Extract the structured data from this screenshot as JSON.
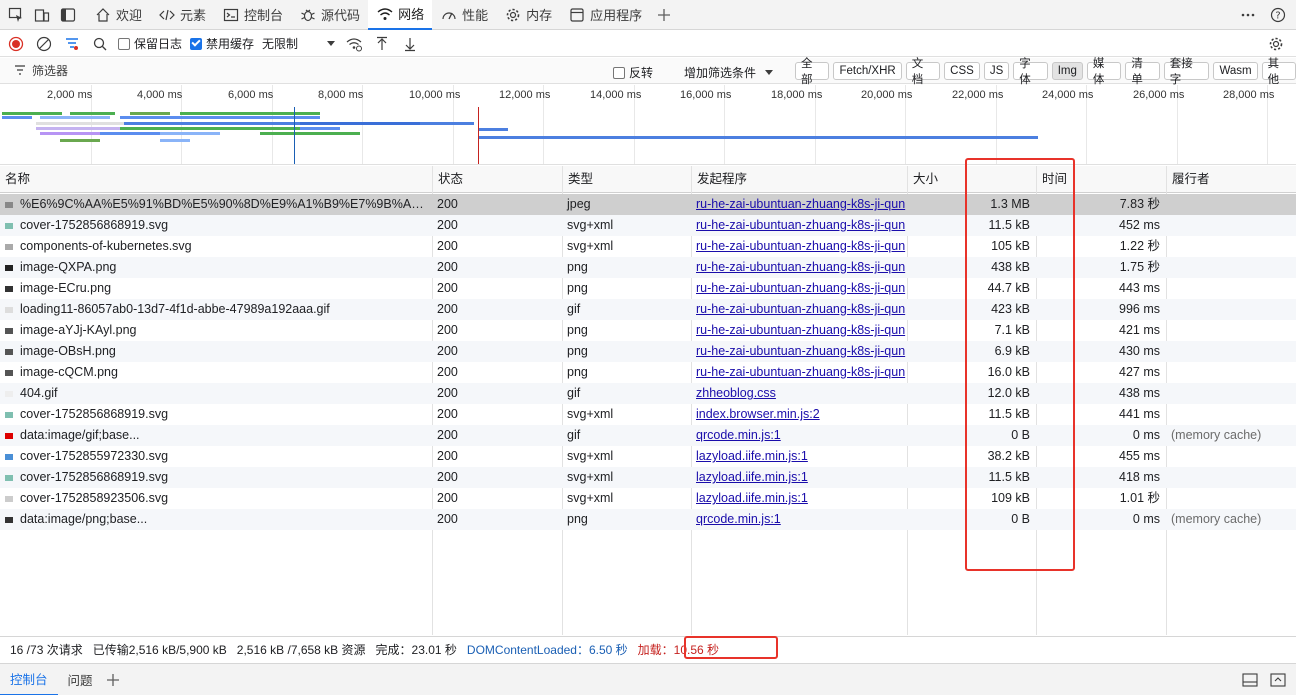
{
  "tabs": [
    {
      "label": "欢迎",
      "icon": "home-icon",
      "active": false
    },
    {
      "label": "元素",
      "icon": "code-icon",
      "active": false
    },
    {
      "label": "控制台",
      "icon": "console-icon",
      "active": false
    },
    {
      "label": "源代码",
      "icon": "bug-icon",
      "active": false
    },
    {
      "label": "网络",
      "icon": "wifi-icon",
      "active": true
    },
    {
      "label": "性能",
      "icon": "gauge-icon",
      "active": false
    },
    {
      "label": "内存",
      "icon": "gear-icon",
      "active": false
    },
    {
      "label": "应用程序",
      "icon": "app-icon",
      "active": false
    }
  ],
  "toolbar": {
    "preserve_log_label": "保留日志",
    "preserve_log_checked": false,
    "disable_cache_label": "禁用缓存",
    "disable_cache_checked": true,
    "throttle_label": "无限制"
  },
  "filterbar": {
    "filter_placeholder": "筛选器",
    "invert_label": "反转",
    "add_filter_label": "增加筛选条件",
    "types": [
      "全部",
      "Fetch/XHR",
      "文档",
      "CSS",
      "JS",
      "字体",
      "Img",
      "媒体",
      "清单",
      "套接字",
      "Wasm",
      "其他"
    ],
    "active_type": "Img"
  },
  "timeline": {
    "ticks": [
      "2,000 ms",
      "4,000 ms",
      "6,000 ms",
      "8,000 ms",
      "10,000 ms",
      "12,000 ms",
      "14,000 ms",
      "16,000 ms",
      "18,000 ms",
      "20,000 ms",
      "22,000 ms",
      "24,000 ms",
      "26,000 ms",
      "28,000 ms"
    ],
    "colors": {
      "dom_content_loaded": "#1a5fb4",
      "load": "#c5221f"
    }
  },
  "table": {
    "headers": {
      "name": "名称",
      "status": "状态",
      "type": "类型",
      "initiator": "发起程序",
      "size": "大小",
      "time": "时间",
      "fulfilled_by": "履行者"
    },
    "rows": [
      {
        "name": "%E6%9C%AA%E5%91%BD%E5%90%8D%E9%A1%B9%E7%9B%AE-...",
        "status": "200",
        "type": "jpeg",
        "initiator": "ru-he-zai-ubuntuan-zhuang-k8s-ji-qun",
        "size": "1.3 MB",
        "time": "7.83 秒",
        "fulfilled": "",
        "icon": "#888"
      },
      {
        "name": "cover-1752856868919.svg",
        "status": "200",
        "type": "svg+xml",
        "initiator": "ru-he-zai-ubuntuan-zhuang-k8s-ji-qun",
        "size": "11.5 kB",
        "time": "452 ms",
        "fulfilled": "",
        "icon": "#7fbfb0"
      },
      {
        "name": "components-of-kubernetes.svg",
        "status": "200",
        "type": "svg+xml",
        "initiator": "ru-he-zai-ubuntuan-zhuang-k8s-ji-qun",
        "size": "105 kB",
        "time": "1.22 秒",
        "fulfilled": "",
        "icon": "#aaa"
      },
      {
        "name": "image-QXPA.png",
        "status": "200",
        "type": "png",
        "initiator": "ru-he-zai-ubuntuan-zhuang-k8s-ji-qun",
        "size": "438 kB",
        "time": "1.75 秒",
        "fulfilled": "",
        "icon": "#222"
      },
      {
        "name": "image-ECru.png",
        "status": "200",
        "type": "png",
        "initiator": "ru-he-zai-ubuntuan-zhuang-k8s-ji-qun",
        "size": "44.7 kB",
        "time": "443 ms",
        "fulfilled": "",
        "icon": "#333"
      },
      {
        "name": "loading11-86057ab0-13d7-4f1d-abbe-47989a192aaa.gif",
        "status": "200",
        "type": "gif",
        "initiator": "ru-he-zai-ubuntuan-zhuang-k8s-ji-qun",
        "size": "423 kB",
        "time": "996 ms",
        "fulfilled": "",
        "icon": "#ddd"
      },
      {
        "name": "image-aYJj-KAyl.png",
        "status": "200",
        "type": "png",
        "initiator": "ru-he-zai-ubuntuan-zhuang-k8s-ji-qun",
        "size": "7.1 kB",
        "time": "421 ms",
        "fulfilled": "",
        "icon": "#555"
      },
      {
        "name": "image-OBsH.png",
        "status": "200",
        "type": "png",
        "initiator": "ru-he-zai-ubuntuan-zhuang-k8s-ji-qun",
        "size": "6.9 kB",
        "time": "430 ms",
        "fulfilled": "",
        "icon": "#555"
      },
      {
        "name": "image-cQCM.png",
        "status": "200",
        "type": "png",
        "initiator": "ru-he-zai-ubuntuan-zhuang-k8s-ji-qun",
        "size": "16.0 kB",
        "time": "427 ms",
        "fulfilled": "",
        "icon": "#555"
      },
      {
        "name": "404.gif",
        "status": "200",
        "type": "gif",
        "initiator": "zhheoblog.css",
        "size": "12.0 kB",
        "time": "438 ms",
        "fulfilled": "",
        "icon": "#eee"
      },
      {
        "name": "cover-1752856868919.svg",
        "status": "200",
        "type": "svg+xml",
        "initiator": "index.browser.min.js:2",
        "size": "11.5 kB",
        "time": "441 ms",
        "fulfilled": "",
        "icon": "#7fbfb0"
      },
      {
        "name": "data:image/gif;base...",
        "status": "200",
        "type": "gif",
        "initiator": "qrcode.min.js:1",
        "size": "0 B",
        "time": "0 ms",
        "fulfilled": "(memory cache)",
        "icon": "#d00"
      },
      {
        "name": "cover-1752855972330.svg",
        "status": "200",
        "type": "svg+xml",
        "initiator": "lazyload.iife.min.js:1",
        "size": "38.2 kB",
        "time": "455 ms",
        "fulfilled": "",
        "icon": "#4a8fd6"
      },
      {
        "name": "cover-1752856868919.svg",
        "status": "200",
        "type": "svg+xml",
        "initiator": "lazyload.iife.min.js:1",
        "size": "11.5 kB",
        "time": "418 ms",
        "fulfilled": "",
        "icon": "#7fbfb0"
      },
      {
        "name": "cover-1752858923506.svg",
        "status": "200",
        "type": "svg+xml",
        "initiator": "lazyload.iife.min.js:1",
        "size": "109 kB",
        "time": "1.01 秒",
        "fulfilled": "",
        "icon": "#ccc"
      },
      {
        "name": "data:image/png;base...",
        "status": "200",
        "type": "png",
        "initiator": "qrcode.min.js:1",
        "size": "0 B",
        "time": "0 ms",
        "fulfilled": "(memory cache)",
        "icon": "#333"
      }
    ]
  },
  "status": {
    "requests": "16 /73 次请求",
    "transferred": "已传输2,516 kB/5,900 kB",
    "resources": "2,516 kB /7,658 kB 资源",
    "finish": "完成：23.01 秒",
    "dcl": "DOMContentLoaded：6.50 秒",
    "load": "加载：10.56 秒"
  },
  "drawer": {
    "tabs": [
      "控制台",
      "问题"
    ]
  }
}
